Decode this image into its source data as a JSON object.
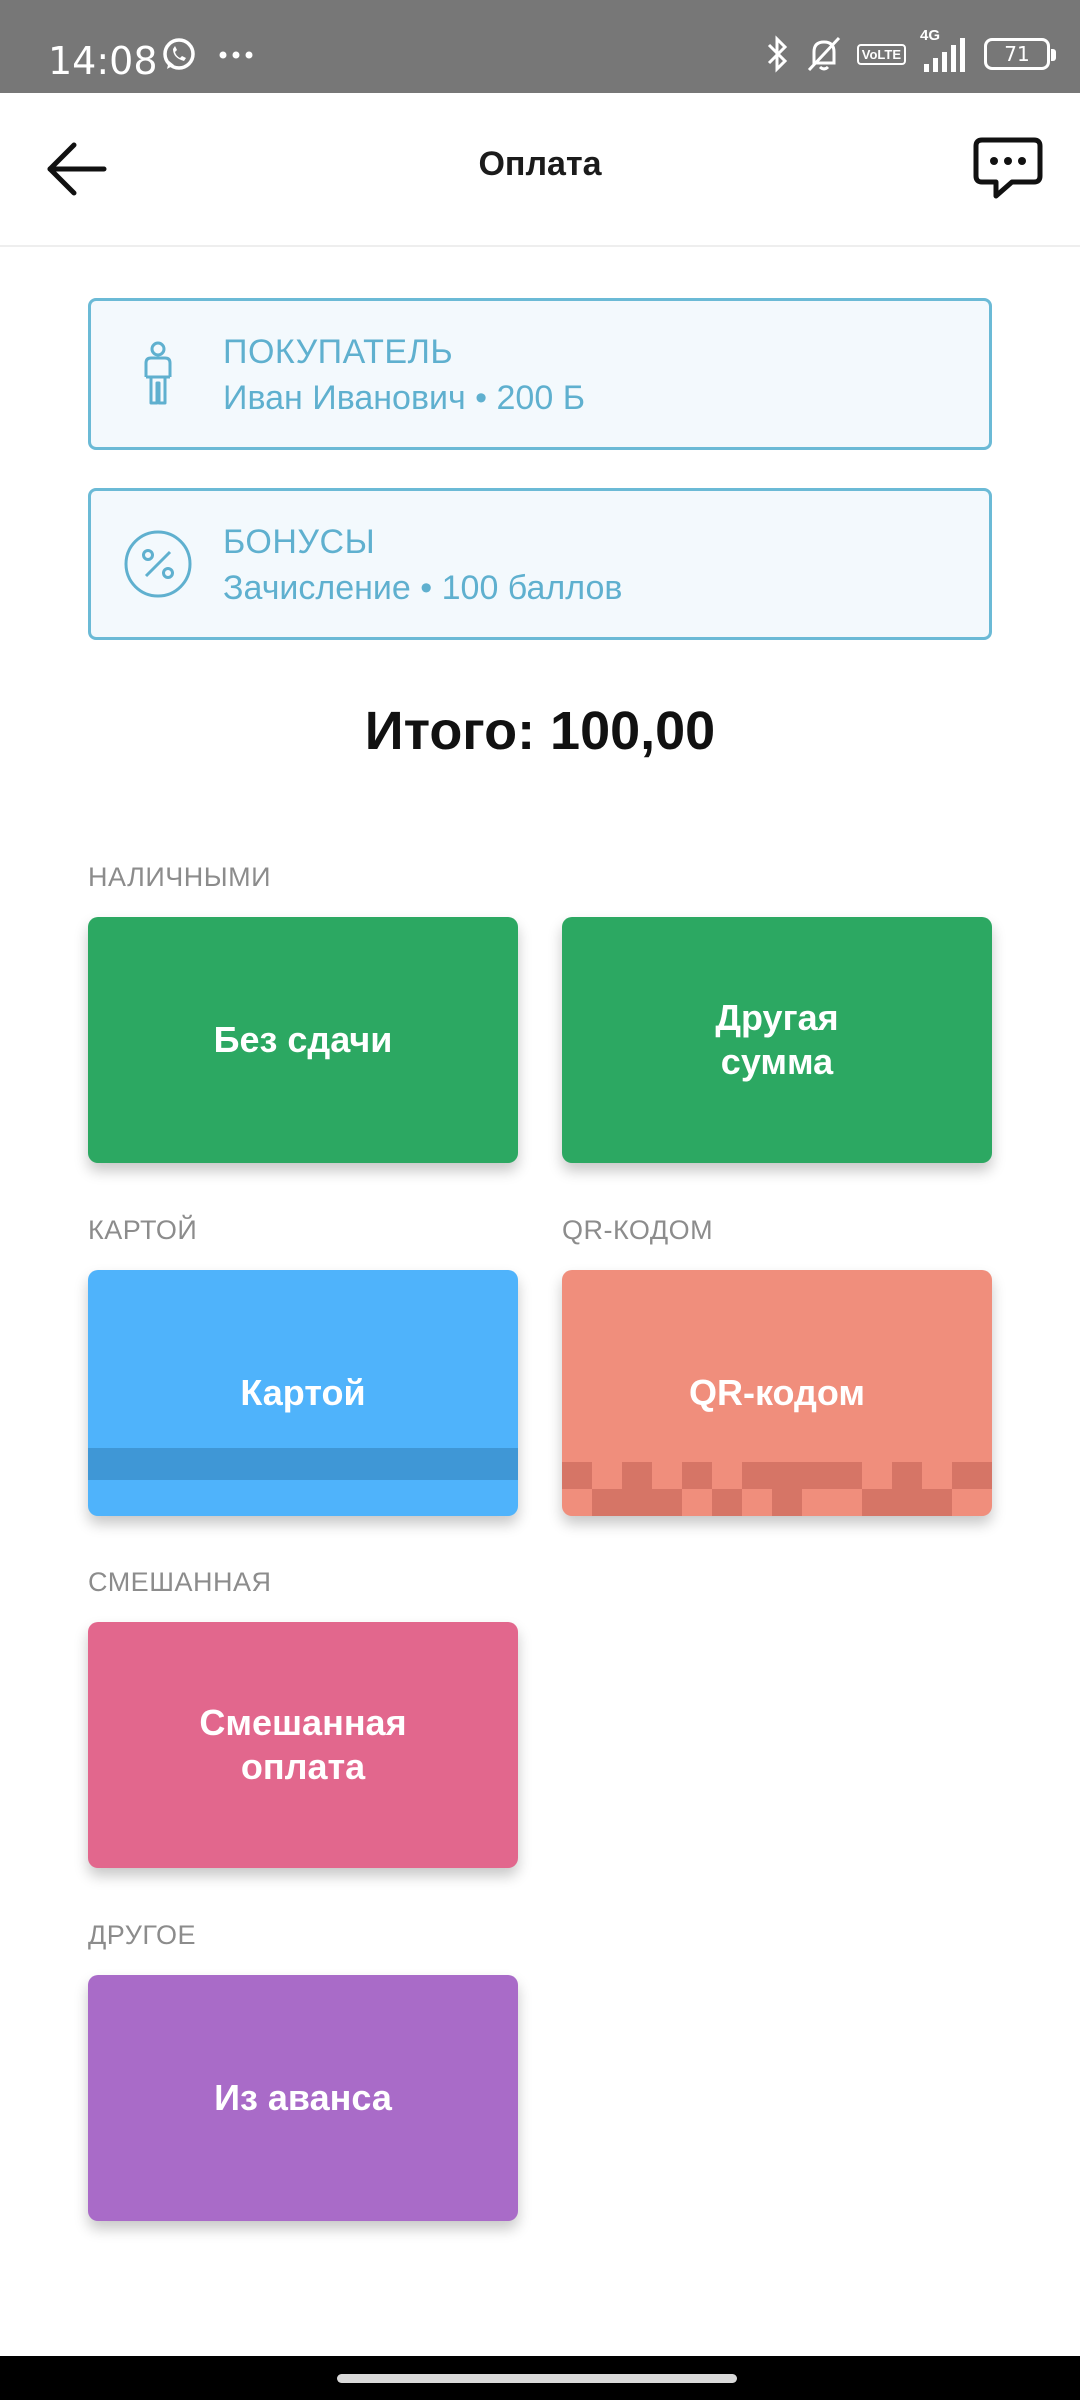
{
  "status_bar": {
    "time": "14:08",
    "icons_left": [
      "whatsapp-icon",
      "more-dots-icon"
    ],
    "icons_right": [
      "bluetooth-icon",
      "bell-off-icon",
      "volte-icon",
      "signal-icon",
      "battery-icon"
    ],
    "volte_top": "Vo",
    "volte_bottom": "LTE",
    "network": "4G",
    "battery": "71"
  },
  "appbar": {
    "title": "Оплата"
  },
  "customer": {
    "title": "ПОКУПАТЕЛЬ",
    "subtitle": "Иван Иванович • 200 Б",
    "icon": "person-icon"
  },
  "bonuses": {
    "title": "БОНУСЫ",
    "subtitle": "Зачисление • 100 баллов",
    "icon": "percent-icon"
  },
  "total": "Итого: 100,00",
  "sections": {
    "cash": {
      "label": "НАЛИЧНЫМИ",
      "buttons": [
        {
          "label": "Без сдачи",
          "color": "#2ca862"
        },
        {
          "label": "Другая\nсумма",
          "color": "#2ca862"
        }
      ]
    },
    "card": {
      "label": "КАРТОЙ",
      "button": {
        "label": "Картой",
        "color": "#4fb3fb"
      }
    },
    "qr": {
      "label": "QR-КОДОМ",
      "button": {
        "label": "QR-кодом",
        "color": "#f08e7c"
      }
    },
    "mixed": {
      "label": "СМЕШАННАЯ",
      "button": {
        "label": "Смешанная\nоплата",
        "color": "#e2678d"
      }
    },
    "other": {
      "label": "ДРУГОЕ",
      "button": {
        "label": "Из аванса",
        "color": "#a96bc8"
      }
    }
  },
  "colors": {
    "accent_info": "#5fb0cf",
    "status_bar": "#777777"
  }
}
